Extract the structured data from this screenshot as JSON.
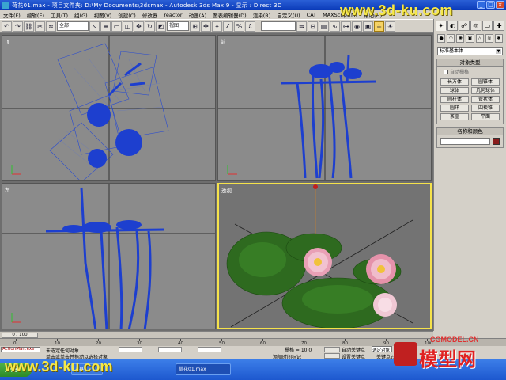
{
  "window": {
    "title": "荷花01.max    - 项目文件夹: D:\\My Documents\\3dsmax    - Autodesk 3ds Max 9    - 显示 : Direct 3D",
    "controls": [
      "_",
      "□",
      "×"
    ]
  },
  "menu": [
    "文件(F)",
    "编辑(E)",
    "工具(T)",
    "组(G)",
    "视图(V)",
    "创建(C)",
    "修改器",
    "reactor",
    "动画(A)",
    "图表编辑器(D)",
    "渲染(R)",
    "自定义(U)",
    "CAT",
    "MAXScript(M)",
    "帮助(H)"
  ],
  "toolbar": {
    "selection_filter": "全部",
    "ref_coord": "视图",
    "buttons": [
      "undo-icon",
      "redo-icon",
      "link-icon",
      "unlink-icon",
      "bind-icon",
      "select-icon",
      "select-name-icon",
      "rect-select-icon",
      "window-icon",
      "move-icon",
      "rotate-icon",
      "scale-icon"
    ]
  },
  "viewports": [
    {
      "label": "顶",
      "name": "top"
    },
    {
      "label": "前",
      "name": "front"
    },
    {
      "label": "左",
      "name": "left"
    },
    {
      "label": "透视",
      "name": "perspective"
    }
  ],
  "command_panel": {
    "category": "标准基本体",
    "object_type_header": "对象类型",
    "autogrid_label": "自动栅格",
    "objects": [
      "长方体",
      "圆锥体",
      "球体",
      "几何球体",
      "圆柱体",
      "管状体",
      "圆环",
      "四棱锥",
      "茶壶",
      "平面"
    ],
    "name_color_header": "名称和颜色",
    "object_color": "#8a1d1d"
  },
  "time": {
    "slider": "0 / 100",
    "ticks": [
      "0",
      "10",
      "20",
      "30",
      "40",
      "50",
      "60",
      "70",
      "80",
      "90",
      "100"
    ]
  },
  "status": {
    "script": "ActionMan.exe",
    "message1": "未选定任何对象",
    "message2": "单击或单击并拖动以选择对象",
    "grid": "栅格 = 10.0",
    "add_time_tag": "添加时间标记",
    "autokey": "自动关键点",
    "setkey": "设置关键点",
    "selected": "选定对象",
    "keyfilter": "关键点过滤器..."
  },
  "taskbar": {
    "start": "开始",
    "items": [
      "工具",
      "荷花01.max"
    ]
  },
  "watermark": {
    "top": "www.3d-ku.com",
    "bottom": "www.3d-ku.com",
    "logo_site": "CGMODEL.CN",
    "logo_big": "模型网"
  }
}
